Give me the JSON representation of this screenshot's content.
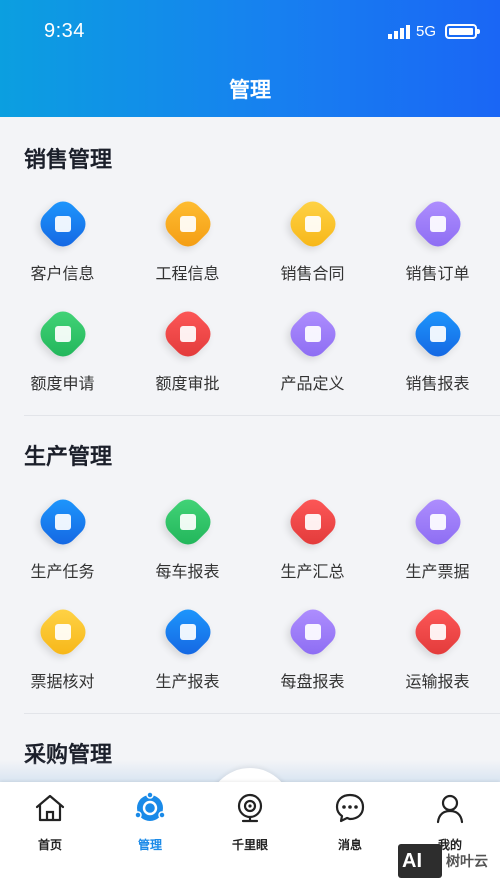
{
  "status_bar": {
    "time": "9:34",
    "network": "5G"
  },
  "header": {
    "title": "管理"
  },
  "sections": [
    {
      "title": "销售管理",
      "items": [
        {
          "label": "客户信息",
          "icon": "customer-icon",
          "color": "#1e7ef0"
        },
        {
          "label": "工程信息",
          "icon": "project-icon",
          "color": "#f6a81f"
        },
        {
          "label": "销售合同",
          "icon": "contract-icon",
          "color": "#f7bf2a"
        },
        {
          "label": "销售订单",
          "icon": "order-icon",
          "color": "#9c7cf7"
        },
        {
          "label": "额度申请",
          "icon": "quota-apply-icon",
          "color": "#2cc366"
        },
        {
          "label": "额度审批",
          "icon": "quota-approve-icon",
          "color": "#ef4848"
        },
        {
          "label": "产品定义",
          "icon": "product-icon",
          "color": "#9c7cf7"
        },
        {
          "label": "销售报表",
          "icon": "sales-report-icon",
          "color": "#1e7ef0"
        }
      ]
    },
    {
      "title": "生产管理",
      "items": [
        {
          "label": "生产任务",
          "icon": "task-icon",
          "color": "#1e7ef0"
        },
        {
          "label": "每车报表",
          "icon": "truck-report-icon",
          "color": "#2cc366"
        },
        {
          "label": "生产汇总",
          "icon": "summary-icon",
          "color": "#ef4848"
        },
        {
          "label": "生产票据",
          "icon": "ticket-icon",
          "color": "#9c7cf7"
        },
        {
          "label": "票据核对",
          "icon": "ticket-check-icon",
          "color": "#f7bf2a"
        },
        {
          "label": "生产报表",
          "icon": "factory-icon",
          "color": "#1e7ef0"
        },
        {
          "label": "每盘报表",
          "icon": "pie-report-icon",
          "color": "#9c7cf7"
        },
        {
          "label": "运输报表",
          "icon": "transport-icon",
          "color": "#ef4848"
        }
      ]
    },
    {
      "title": "采购管理",
      "items": []
    }
  ],
  "tabbar": {
    "items": [
      {
        "label": "首页",
        "icon": "home-icon"
      },
      {
        "label": "管理",
        "icon": "management-icon",
        "active": true
      },
      {
        "label": "千里眼",
        "icon": "camera-icon"
      },
      {
        "label": "消息",
        "icon": "message-icon"
      },
      {
        "label": "我的",
        "icon": "profile-icon"
      }
    ]
  },
  "watermark": {
    "logo": "AI",
    "text": "树叶云"
  },
  "colors": {
    "accent": "#1a8ae8",
    "header_start": "#0b9fe0",
    "header_end": "#1a66f5"
  }
}
